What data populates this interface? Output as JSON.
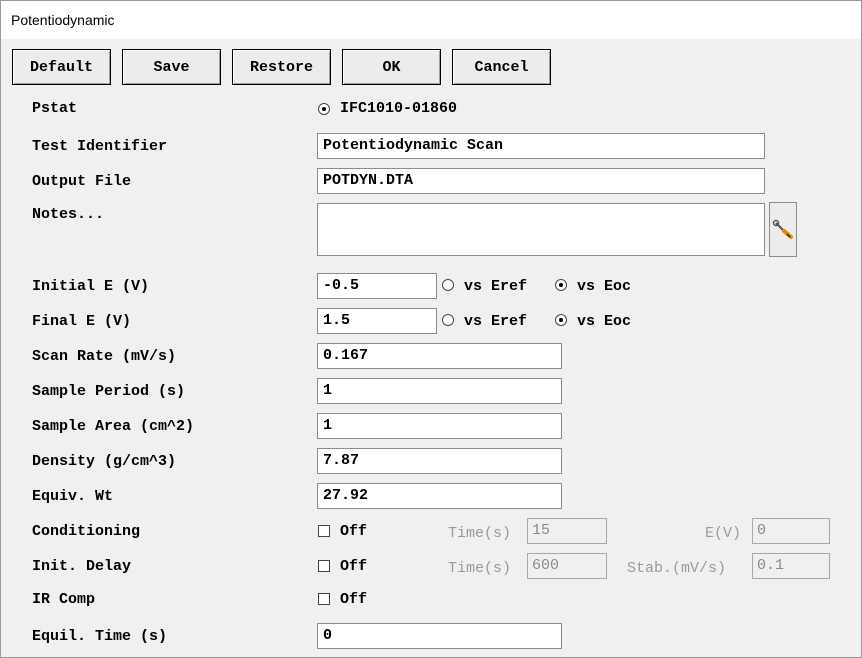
{
  "window": {
    "title": "Potentiodynamic"
  },
  "toolbar": {
    "default_label": "Default",
    "save_label": "Save",
    "restore_label": "Restore",
    "ok_label": "OK",
    "cancel_label": "Cancel"
  },
  "form": {
    "pstat": {
      "label": "Pstat",
      "option": "IFC1010-01860",
      "selected": true
    },
    "test_identifier": {
      "label": "Test Identifier",
      "value": "Potentiodynamic Scan"
    },
    "output_file": {
      "label": "Output File",
      "value": "POTDYN.DTA"
    },
    "notes": {
      "label": "Notes...",
      "value": "",
      "button_icon": "wrench-screwdriver-icon"
    },
    "initial_e": {
      "label": "Initial E (V)",
      "value": "-0.5",
      "ref_option_1": "vs Eref",
      "ref_option_2": "vs Eoc",
      "selected": "vs Eoc"
    },
    "final_e": {
      "label": "Final E (V)",
      "value": "1.5",
      "ref_option_1": "vs Eref",
      "ref_option_2": "vs Eoc",
      "selected": "vs Eoc"
    },
    "scan_rate": {
      "label": "Scan Rate (mV/s)",
      "value": "0.167"
    },
    "sample_period": {
      "label": "Sample Period (s)",
      "value": "1"
    },
    "sample_area": {
      "label": "Sample Area (cm^2)",
      "value": "1"
    },
    "density": {
      "label": "Density (g/cm^3)",
      "value": "7.87"
    },
    "equiv_wt": {
      "label": "Equiv. Wt",
      "value": "27.92"
    },
    "conditioning": {
      "label": "Conditioning",
      "check_label": "Off",
      "checked": false,
      "time_label": "Time(s)",
      "time_value": "15",
      "e_label": "E(V)",
      "e_value": "0"
    },
    "init_delay": {
      "label": "Init. Delay",
      "check_label": "Off",
      "checked": false,
      "time_label": "Time(s)",
      "time_value": "600",
      "stab_label": "Stab.(mV/s)",
      "stab_value": "0.1"
    },
    "ir_comp": {
      "label": "IR Comp",
      "check_label": "Off",
      "checked": false
    },
    "equil_time": {
      "label": "Equil. Time (s)",
      "value": "0"
    }
  }
}
